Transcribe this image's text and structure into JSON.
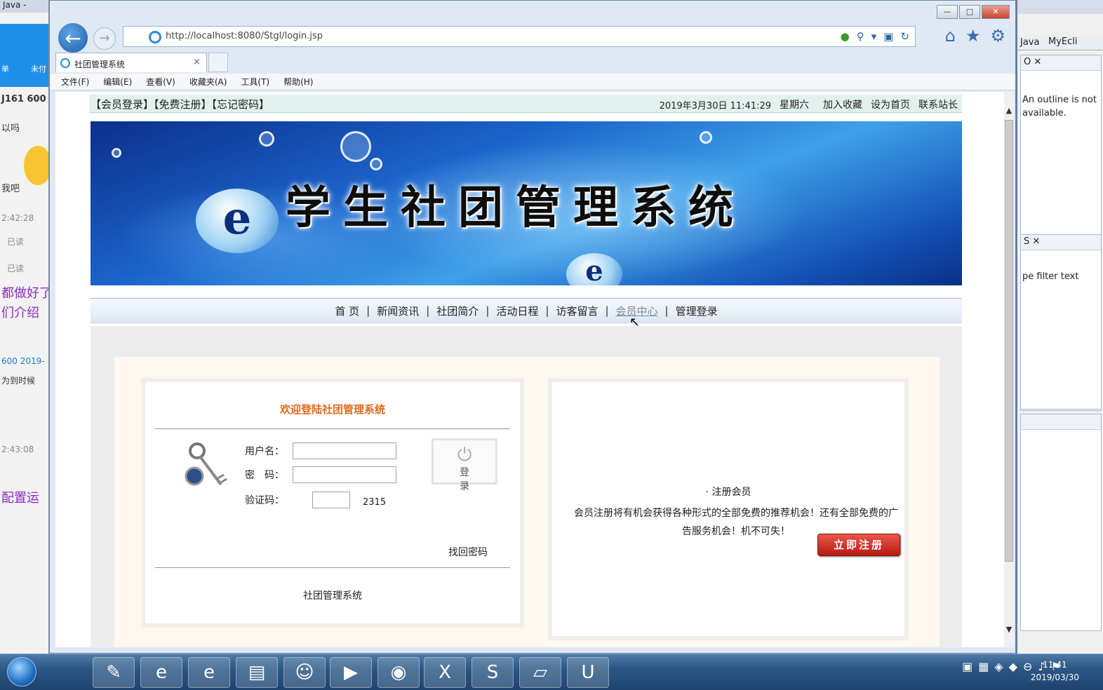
{
  "left_app": {
    "title": "Java -",
    "lines": [
      "单",
      "未付",
      "J161 600",
      "以吗",
      "我吧",
      "2:42:28",
      "已读",
      "已读",
      "都做好了",
      "们介绍",
      "600  2019-",
      "为到时候",
      "2:43:08",
      "配置运"
    ]
  },
  "browser": {
    "url": "http://localhost:8080/Stgl/login.jsp",
    "tab_title": "社团管理系统",
    "tab_close": "×",
    "back_glyph": "←",
    "forward_glyph": "→",
    "menu": [
      "文件(F)",
      "编辑(E)",
      "查看(V)",
      "收藏夹(A)",
      "工具(T)",
      "帮助(H)"
    ],
    "icons": [
      "home-icon",
      "favorites-star-icon",
      "settings-gear-icon",
      "refresh-icon",
      "search-icon"
    ]
  },
  "page": {
    "top_left": "【会员登录】【免费注册】【忘记密码】",
    "datetime": "2019年3月30日 11:41:29",
    "weekday": "星期六",
    "top_links": [
      "加入收藏",
      "设为首页",
      "联系站长"
    ],
    "banner_title": "学生社团管理系统",
    "banner_e": "e",
    "nav": [
      "首 页",
      "新闻资讯",
      "社团简介",
      "活动日程",
      "访客留言",
      "会员中心",
      "管理登录"
    ],
    "login": {
      "heading": "欢迎登陆社团管理系统",
      "username_label": "用户名：",
      "password_label": "密　码：",
      "captcha_label": "验证码：",
      "captcha_code": "2315",
      "login_button": "登录",
      "forgot": "找回密码",
      "footer": "社团管理系统"
    },
    "register": {
      "title": "· 注册会员",
      "text": "会员注册将有机会获得各种形式的全部免费的推荐机会！还有全部免费的广告服务机会！机不可失！",
      "button": "立即注册"
    }
  },
  "eclipse": {
    "tab1": "Java",
    "tab2": "MyEcli",
    "outline_tab": "O",
    "outline_text": "An outline is not available.",
    "view2_tab": "S",
    "filter_text": "pe filter text"
  },
  "taskbar": {
    "time": "11:41",
    "date": "2019/03/30"
  },
  "colors": {
    "heading_orange": "#e06a1a",
    "register_red": "#c8281c",
    "topbar_bg": "#e2f1ee"
  }
}
